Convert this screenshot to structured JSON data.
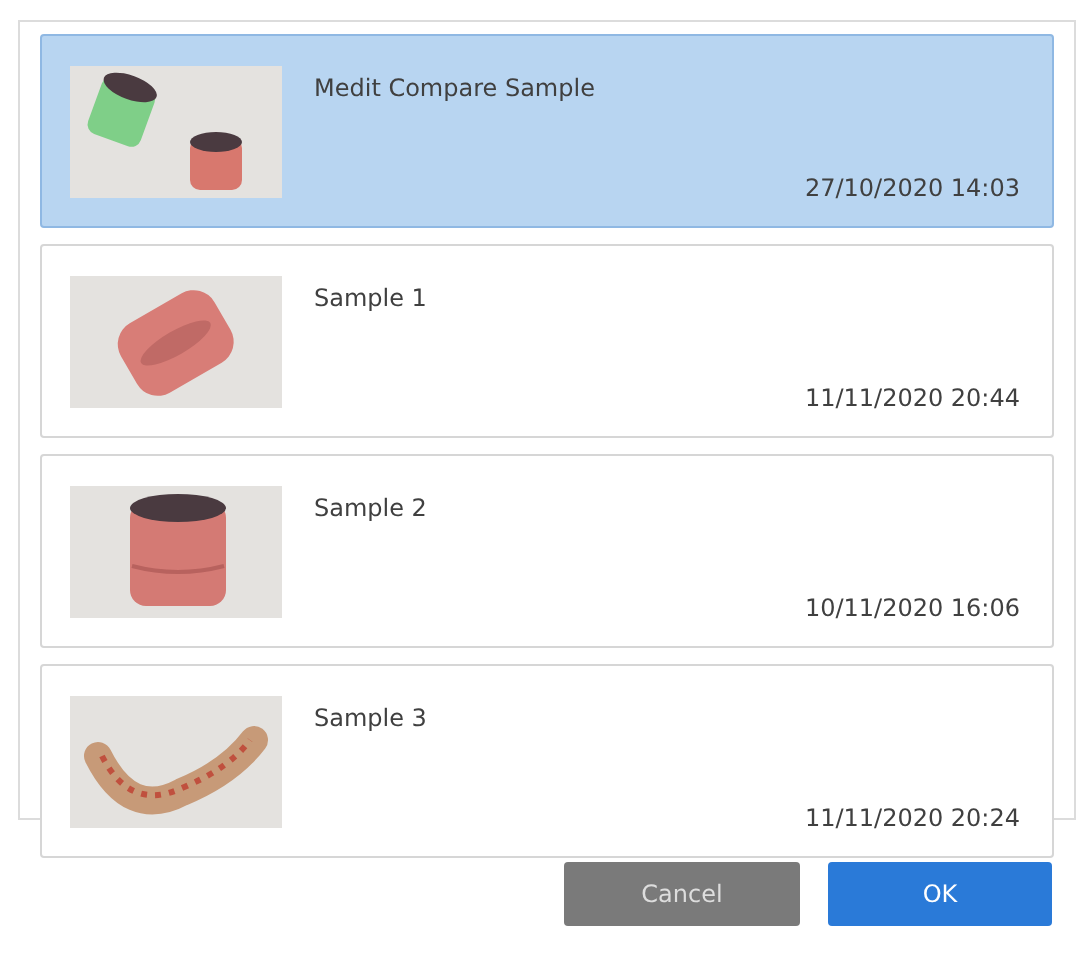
{
  "samples": [
    {
      "kind": "pair",
      "title": "Medit Compare Sample",
      "date": "27/10/2020 14:03",
      "selected": true
    },
    {
      "kind": "tilted",
      "title": "Sample 1",
      "date": "11/11/2020 20:44",
      "selected": false
    },
    {
      "kind": "upright",
      "title": "Sample 2",
      "date": "10/11/2020 16:06",
      "selected": false
    },
    {
      "kind": "arch",
      "title": "Sample 3",
      "date": "11/11/2020 20:24",
      "selected": false
    }
  ],
  "buttons": [
    {
      "kind": "secondary",
      "label": "Cancel"
    },
    {
      "kind": "primary",
      "label": "OK"
    }
  ]
}
